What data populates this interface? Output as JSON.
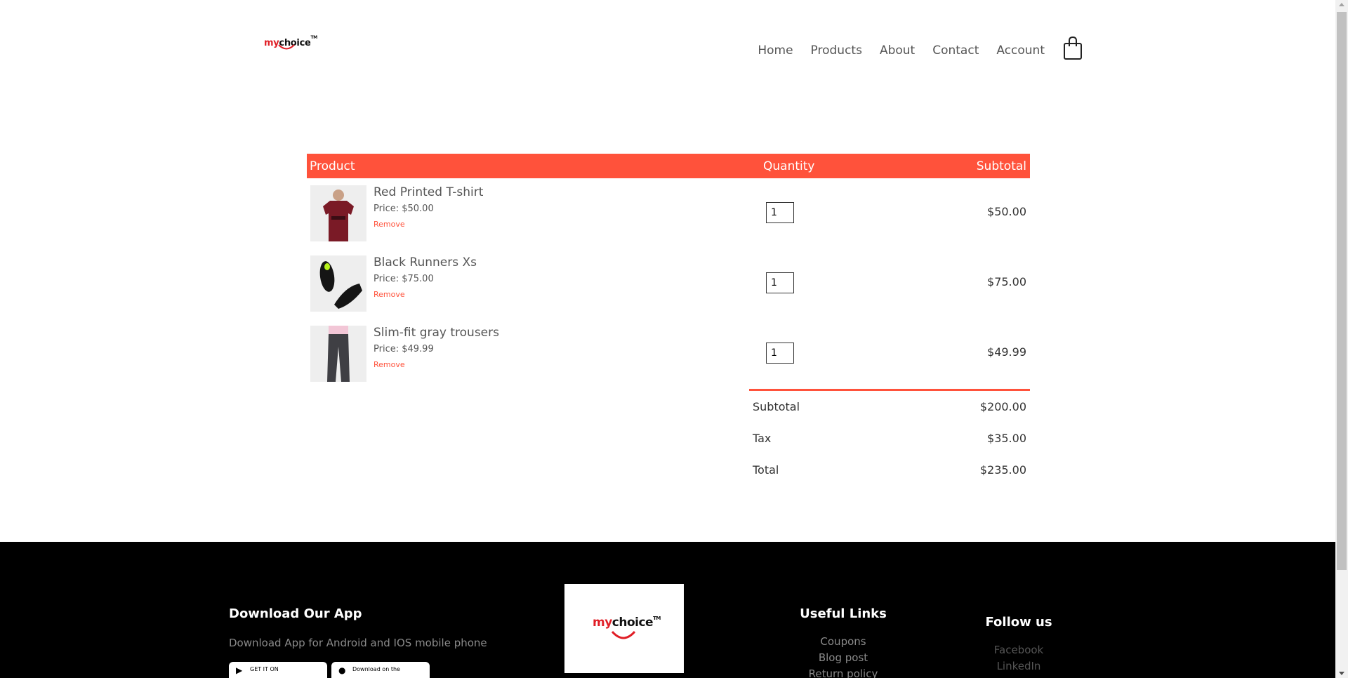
{
  "brand": {
    "logo_my": "my",
    "logo_choice": "choice",
    "logo_tm": "TM"
  },
  "nav": {
    "items": [
      {
        "label": "Home"
      },
      {
        "label": "Products"
      },
      {
        "label": "About"
      },
      {
        "label": "Contact"
      },
      {
        "label": "Account"
      }
    ],
    "cart_icon": "shopping-bag-icon"
  },
  "cart": {
    "headers": {
      "product": "Product",
      "quantity": "Quantity",
      "subtotal": "Subtotal"
    },
    "items": [
      {
        "name": "Red Printed T-shirt",
        "price": "Price: $50.00",
        "remove": "Remove",
        "quantity": "1",
        "subtotal": "$50.00",
        "image": "red-tshirt"
      },
      {
        "name": "Black Runners Xs",
        "price": "Price: $75.00",
        "remove": "Remove",
        "quantity": "1",
        "subtotal": "$75.00",
        "image": "black-shoes"
      },
      {
        "name": "Slim-fit gray trousers",
        "price": "Price: $49.99",
        "remove": "Remove",
        "quantity": "1",
        "subtotal": "$49.99",
        "image": "gray-trousers"
      }
    ],
    "totals": [
      {
        "label": "Subtotal",
        "value": "$200.00"
      },
      {
        "label": "Tax",
        "value": "$35.00"
      },
      {
        "label": "Total",
        "value": "$235.00"
      }
    ]
  },
  "footer": {
    "app": {
      "title": "Download Our App",
      "text": "Download App for Android and IOS mobile phone",
      "google_play": "GET IT ON",
      "app_store": "Download on the"
    },
    "useful_links": {
      "title": "Useful Links",
      "items": [
        "Coupons",
        "Blog post",
        "Return policy"
      ]
    },
    "follow": {
      "title": "Follow us",
      "items": [
        "Facebook",
        "LinkedIn"
      ]
    }
  },
  "colors": {
    "accent": "#ff523b",
    "footer_bg": "#000000",
    "logo_red": "#e01e26"
  }
}
